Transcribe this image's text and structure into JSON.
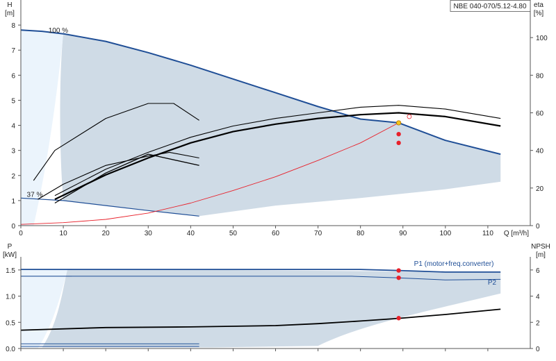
{
  "chart_data": [
    {
      "type": "line",
      "title": "NBE 040-070/5.12-4.80",
      "xlabel": "Q [m³/h]",
      "ylabel_left_name": "H",
      "ylabel_left_unit": "[m]",
      "ylabel_right_name": "eta",
      "ylabel_right_unit": "[%]",
      "xlim": [
        0,
        120
      ],
      "ylim_left": [
        0,
        9
      ],
      "ylim_right": [
        0,
        120
      ],
      "x_ticks": [
        "0",
        "10",
        "20",
        "30",
        "40",
        "50",
        "60",
        "70",
        "80",
        "90",
        "100",
        "110"
      ],
      "y_left_ticks": [
        "0",
        "1",
        "2",
        "3",
        "4",
        "5",
        "6",
        "7",
        "8"
      ],
      "y_right_ticks": [
        "0",
        "20",
        "40",
        "60",
        "80",
        "100"
      ],
      "annotations": [
        "100 %",
        "37 %"
      ],
      "operating_point": {
        "q": 89,
        "h": 4.1
      },
      "series": [
        {
          "id": "h100",
          "axis": "left",
          "color": "#1f4e96",
          "width": 2,
          "x": [
            0,
            5,
            10,
            20,
            30,
            40,
            50,
            60,
            70,
            80,
            89,
            100,
            113
          ],
          "y": [
            7.8,
            7.75,
            7.65,
            7.35,
            6.9,
            6.4,
            5.85,
            5.3,
            4.75,
            4.25,
            4.1,
            3.4,
            2.85
          ]
        },
        {
          "id": "h37",
          "axis": "left",
          "color": "#1f4e96",
          "width": 1.2,
          "x": [
            0,
            10,
            20,
            30,
            42
          ],
          "y": [
            1.1,
            1.0,
            0.8,
            0.6,
            0.38
          ]
        },
        {
          "id": "h_system",
          "axis": "left",
          "color": "#e8202a",
          "width": 0.9,
          "x": [
            0,
            10,
            20,
            30,
            40,
            50,
            60,
            70,
            80,
            89
          ],
          "y": [
            0.05,
            0.12,
            0.25,
            0.5,
            0.9,
            1.4,
            1.95,
            2.6,
            3.3,
            4.1
          ]
        },
        {
          "id": "eta1",
          "axis": "right",
          "color": "#000",
          "width": 2.2,
          "x": [
            8,
            20,
            30,
            40,
            50,
            60,
            70,
            80,
            89,
            100,
            113
          ],
          "y": [
            14,
            27,
            36,
            44,
            50,
            54,
            57,
            59,
            60,
            58,
            53
          ]
        },
        {
          "id": "eta2",
          "axis": "right",
          "color": "#000",
          "width": 1.1,
          "x": [
            8,
            20,
            30,
            40,
            50,
            60,
            70,
            80,
            89,
            100,
            113
          ],
          "y": [
            16,
            30,
            39,
            47,
            53,
            57,
            60,
            63,
            64,
            62,
            57
          ]
        },
        {
          "id": "eta3",
          "axis": "right",
          "color": "#000",
          "width": 1.1,
          "x": [
            4,
            10,
            20,
            30,
            35,
            42
          ],
          "y": [
            14,
            22,
            32,
            37,
            39,
            36
          ]
        },
        {
          "id": "eta4",
          "axis": "right",
          "color": "#000",
          "width": 1.1,
          "x": [
            3,
            8,
            20,
            30,
            36,
            42
          ],
          "y": [
            24,
            40,
            57,
            65,
            65,
            56
          ]
        },
        {
          "id": "eta_low",
          "axis": "right",
          "color": "#000",
          "width": 1.3,
          "x": [
            8,
            20,
            30,
            42
          ],
          "y": [
            12,
            28,
            38,
            32
          ]
        }
      ],
      "markers": [
        {
          "x": 89,
          "y": 4.1,
          "axis": "left",
          "color": "#f5c518"
        },
        {
          "x": 89,
          "y": 3.65,
          "axis": "left",
          "color": "#e8202a"
        },
        {
          "x": 89,
          "y": 3.3,
          "axis": "left",
          "color": "#e8202a"
        }
      ]
    },
    {
      "type": "line",
      "xlabel": "",
      "ylabel_left_name": "P",
      "ylabel_left_unit": "[kW]",
      "ylabel_right_name": "NPSH",
      "ylabel_right_unit": "[m]",
      "xlim": [
        0,
        120
      ],
      "ylim_left": [
        0,
        1.75
      ],
      "ylim_right": [
        0,
        7
      ],
      "y_left_ticks": [
        "0.0",
        "0.5",
        "1.0",
        "1.5"
      ],
      "y_right_ticks": [
        "0",
        "2",
        "4",
        "6"
      ],
      "legend": [
        "P1 (motor+freq.converter)",
        "P2"
      ],
      "series": [
        {
          "id": "p1",
          "axis": "left",
          "color": "#1f4e96",
          "width": 1.8,
          "x": [
            0,
            12,
            40,
            70,
            80,
            89,
            100,
            113
          ],
          "y": [
            1.51,
            1.51,
            1.51,
            1.51,
            1.51,
            1.49,
            1.46,
            1.46
          ]
        },
        {
          "id": "p2",
          "axis": "left",
          "color": "#1f4e96",
          "width": 1.0,
          "x": [
            0,
            12,
            40,
            78,
            89,
            100,
            113
          ],
          "y": [
            1.38,
            1.38,
            1.38,
            1.38,
            1.35,
            1.31,
            1.32
          ]
        },
        {
          "id": "npsh",
          "axis": "right",
          "color": "#000",
          "width": 1.8,
          "x": [
            0,
            20,
            40,
            60,
            70,
            80,
            89,
            100,
            113
          ],
          "y": [
            1.4,
            1.6,
            1.65,
            1.75,
            1.9,
            2.1,
            2.3,
            2.6,
            3.0
          ]
        },
        {
          "id": "p_low1",
          "axis": "left",
          "color": "#1f4e96",
          "width": 1.0,
          "x": [
            0,
            42
          ],
          "y": [
            0.09,
            0.09
          ]
        },
        {
          "id": "p_low2",
          "axis": "left",
          "color": "#1f4e96",
          "width": 1.0,
          "x": [
            0,
            42
          ],
          "y": [
            0.04,
            0.04
          ]
        }
      ],
      "markers": [
        {
          "x": 89,
          "y": 1.49,
          "axis": "left",
          "color": "#e8202a"
        },
        {
          "x": 89,
          "y": 1.35,
          "axis": "left",
          "color": "#e8202a"
        },
        {
          "x": 89,
          "y": 0.58,
          "axis": "left",
          "color": "#e8202a"
        }
      ]
    }
  ]
}
